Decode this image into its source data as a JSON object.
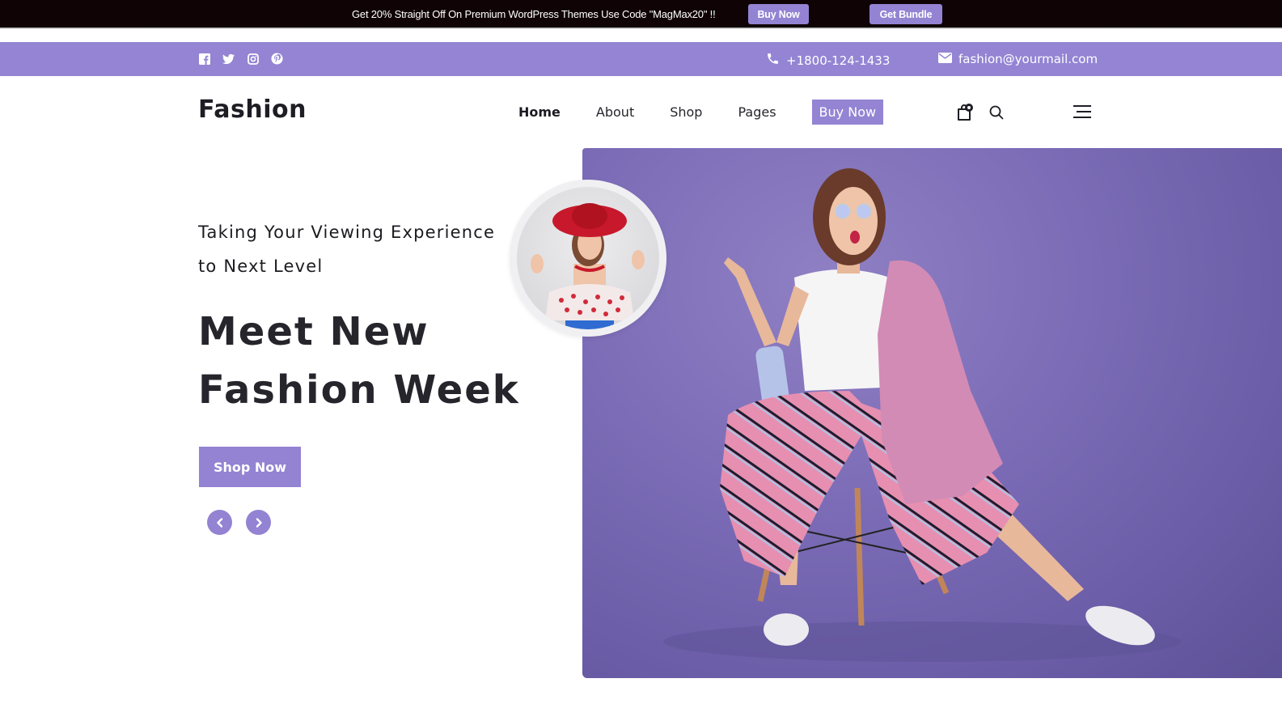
{
  "promo": {
    "text": "Get 20% Straight Off On Premium WordPress Themes Use Code \"MagMax20\" !!",
    "buy_now_label": "Buy Now",
    "get_bundle_label": "Get Bundle"
  },
  "topbar": {
    "social_icons": [
      "facebook-icon",
      "twitter-icon",
      "instagram-icon",
      "pinterest-icon"
    ],
    "phone": "+1800-124-1433",
    "email": "fashion@yourmail.com"
  },
  "header": {
    "logo": "Fashion",
    "nav": [
      {
        "label": "Home",
        "active": true
      },
      {
        "label": "About",
        "active": false
      },
      {
        "label": "Shop",
        "active": false
      },
      {
        "label": "Pages",
        "active": false
      }
    ],
    "buy_now_label": "Buy Now",
    "cart_count": "0"
  },
  "hero": {
    "subtitle": "Taking Your Viewing Experience to Next Level",
    "headline_line1": "Meet New",
    "headline_line2": "Fashion Week",
    "cta_label": "Shop Now",
    "prev_icon": "chevron-left-icon",
    "next_icon": "chevron-right-icon"
  },
  "colors": {
    "accent": "#9484d3",
    "promo_bg": "#0f0305",
    "text_dark": "#1e1d24",
    "hero_bg": "#7c6cb7"
  }
}
